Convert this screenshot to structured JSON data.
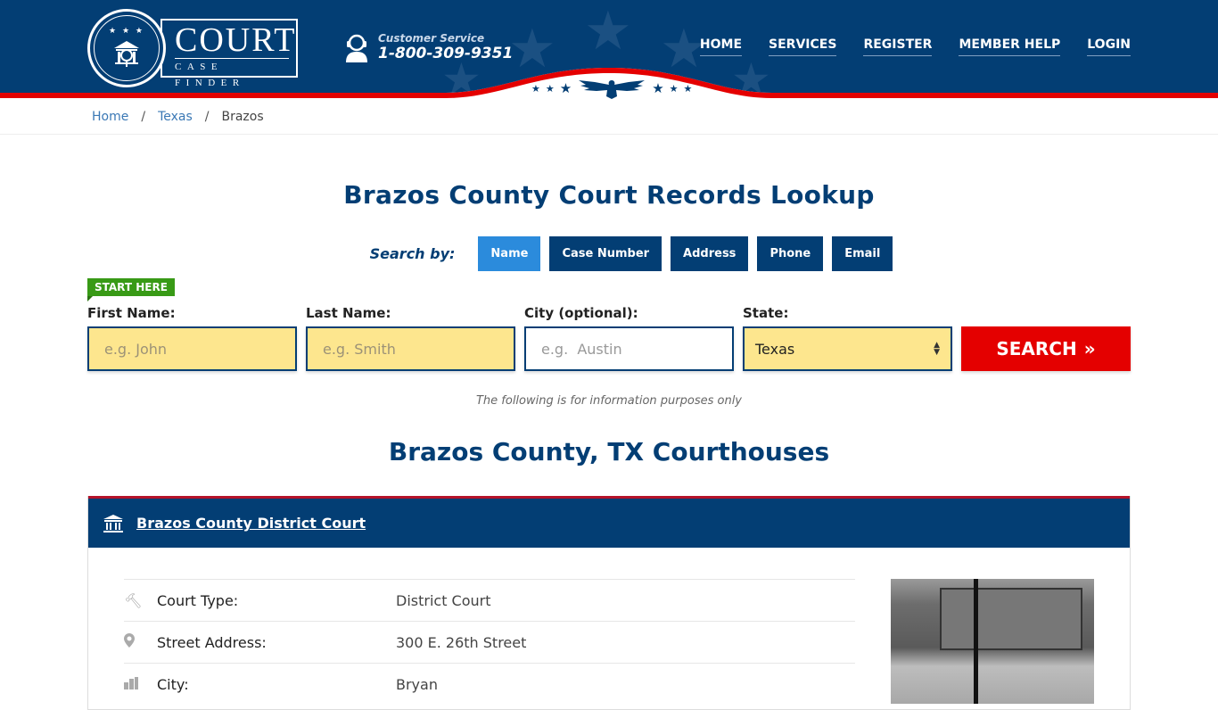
{
  "header": {
    "logo": {
      "title": "COURT",
      "subtitle": "CASE FINDER",
      "seal_stars": "★ ★ ★"
    },
    "customer_service": {
      "label": "Customer Service",
      "phone": "1-800-309-9351"
    },
    "nav": [
      {
        "label": "HOME"
      },
      {
        "label": "SERVICES"
      },
      {
        "label": "REGISTER"
      },
      {
        "label": "MEMBER HELP"
      },
      {
        "label": "LOGIN"
      }
    ],
    "colors": {
      "navy": "#033e74",
      "red": "#e40000",
      "accent_blue": "#2b8bdc",
      "green": "#389a16",
      "field_yellow": "#fde68e"
    }
  },
  "breadcrumb": [
    {
      "label": "Home"
    },
    {
      "label": "Texas"
    },
    {
      "label": "Brazos"
    }
  ],
  "breadcrumb_sep": "/",
  "page_title": "Brazos County Court Records Lookup",
  "search": {
    "search_by_label": "Search by:",
    "tabs": [
      {
        "label": "Name",
        "active": true
      },
      {
        "label": "Case Number",
        "active": false
      },
      {
        "label": "Address",
        "active": false
      },
      {
        "label": "Phone",
        "active": false
      },
      {
        "label": "Email",
        "active": false
      }
    ],
    "start_badge": "START HERE",
    "fields": {
      "first_name": {
        "label": "First Name:",
        "placeholder": "e.g. John",
        "value": ""
      },
      "last_name": {
        "label": "Last Name:",
        "placeholder": "e.g. Smith",
        "value": ""
      },
      "city": {
        "label": "City (optional):",
        "placeholder": "e.g.  Austin",
        "value": ""
      },
      "state": {
        "label": "State:",
        "selected": "Texas"
      }
    },
    "search_button": "SEARCH",
    "search_button_icon": "»"
  },
  "info_note": "The following is for information purposes only",
  "courthouses_title": "Brazos County, TX Courthouses",
  "court": {
    "name": "Brazos County District Court",
    "rows": [
      {
        "icon": "gavel-icon",
        "key": "Court Type:",
        "value": "District Court"
      },
      {
        "icon": "map-pin-icon",
        "key": "Street Address:",
        "value": "300 E. 26th Street"
      },
      {
        "icon": "city-icon",
        "key": "City:",
        "value": "Bryan"
      }
    ]
  }
}
